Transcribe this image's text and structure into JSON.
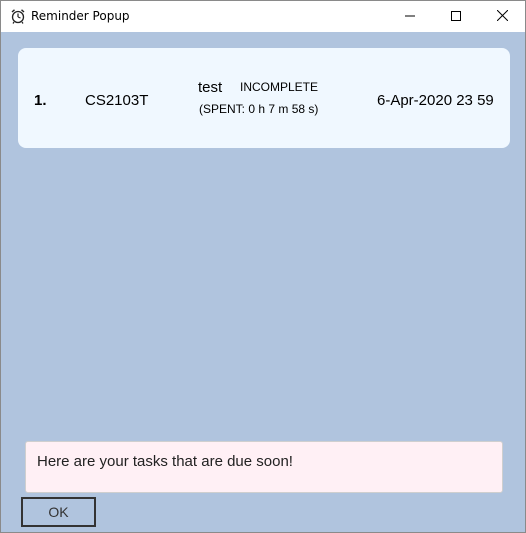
{
  "window": {
    "title": "Reminder Popup"
  },
  "tasks": [
    {
      "index": "1.",
      "module": "CS2103T",
      "name": "test",
      "status": "INCOMPLETE",
      "spent": "(SPENT: 0 h 7 m 58 s)",
      "due": "6-Apr-2020 23 59"
    }
  ],
  "message": "Here are your tasks that are due soon!",
  "ok_label": "OK",
  "colors": {
    "window_background": "#b0c4de",
    "card_background": "#f0f8ff",
    "message_background": "#fff0f5"
  },
  "icons": {
    "app": "alarm-clock-icon",
    "minimize": "minimize-icon",
    "maximize": "maximize-icon",
    "close": "close-icon"
  }
}
